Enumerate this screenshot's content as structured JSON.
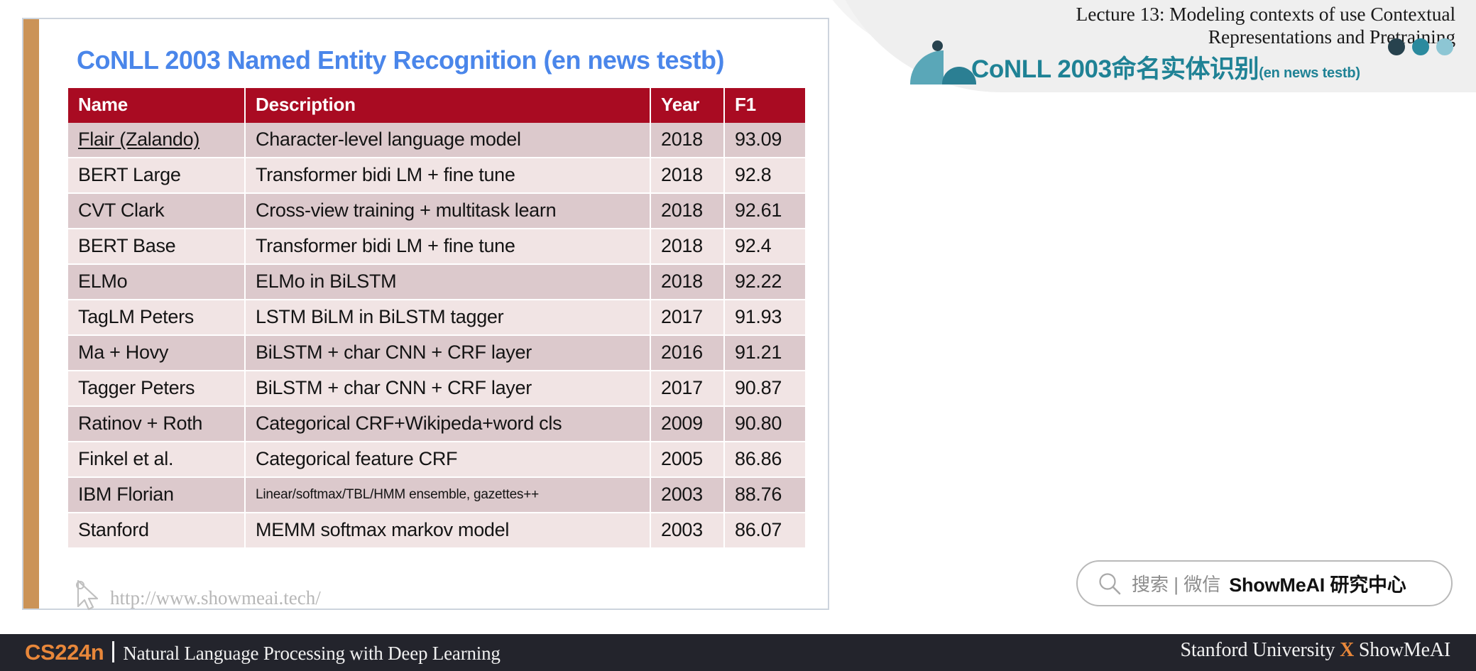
{
  "header": {
    "lecture_line1": "Lecture 13:  Modeling contexts of use Contextual",
    "lecture_line2": "Representations and Pretraining",
    "brand_title": "CoNLL 2003命名实体识别",
    "brand_subtitle": "(en news testb)",
    "dot_colors": [
      "#27424e",
      "#2b8a9e",
      "#8dc6d4"
    ],
    "mark_colors": {
      "quarter": "#5aa7b8",
      "dome": "#2b7f93",
      "dot": "#27424e"
    }
  },
  "card": {
    "title": "CoNLL 2003 Named Entity Recognition (en news testb)",
    "title_color": "#4a86ea",
    "accent_color": "#cb9357",
    "watermark": "http://www.showmeai.tech/"
  },
  "table": {
    "header_color": "#a90b22",
    "row_odd_color": "#dcc9cc",
    "row_even_color": "#f1e4e4",
    "columns": [
      "Name",
      "Description",
      "Year",
      "F1"
    ],
    "rows": [
      {
        "name": "Flair (Zalando)",
        "underline": true,
        "small_desc": false,
        "description": "Character-level language model",
        "year": "2018",
        "f1": "93.09"
      },
      {
        "name": "BERT Large",
        "underline": false,
        "small_desc": false,
        "description": "Transformer bidi LM + fine tune",
        "year": "2018",
        "f1": "92.8"
      },
      {
        "name": "CVT Clark",
        "underline": false,
        "small_desc": false,
        "description": "Cross-view training + multitask learn",
        "year": "2018",
        "f1": "92.61"
      },
      {
        "name": "BERT Base",
        "underline": false,
        "small_desc": false,
        "description": "Transformer bidi LM + fine tune",
        "year": "2018",
        "f1": "92.4"
      },
      {
        "name": "ELMo",
        "underline": false,
        "small_desc": false,
        "description": "ELMo in BiLSTM",
        "year": "2018",
        "f1": "92.22"
      },
      {
        "name": "TagLM Peters",
        "underline": false,
        "small_desc": false,
        "description": "LSTM BiLM in BiLSTM tagger",
        "year": "2017",
        "f1": "91.93"
      },
      {
        "name": "Ma + Hovy",
        "underline": false,
        "small_desc": false,
        "description": "BiLSTM + char CNN + CRF layer",
        "year": "2016",
        "f1": "91.21"
      },
      {
        "name": "Tagger Peters",
        "underline": false,
        "small_desc": false,
        "description": "BiLSTM + char CNN + CRF layer",
        "year": "2017",
        "f1": "90.87"
      },
      {
        "name": "Ratinov + Roth",
        "underline": false,
        "small_desc": false,
        "description": "Categorical CRF+Wikipeda+word cls",
        "year": "2009",
        "f1": "90.80"
      },
      {
        "name": "Finkel et al.",
        "underline": false,
        "small_desc": false,
        "description": "Categorical feature CRF",
        "year": "2005",
        "f1": "86.86"
      },
      {
        "name": "IBM Florian",
        "underline": false,
        "small_desc": true,
        "description": "Linear/softmax/TBL/HMM ensemble, gazettes++",
        "year": "2003",
        "f1": "88.76"
      },
      {
        "name": "Stanford",
        "underline": false,
        "small_desc": false,
        "description": "MEMM softmax markov model",
        "year": "2003",
        "f1": "86.07"
      }
    ]
  },
  "search": {
    "placeholder": "搜索 | 微信",
    "brand": "ShowMeAI 研究中心"
  },
  "footer": {
    "course_code": "CS224n",
    "course_name": "Natural Language Processing with Deep Learning",
    "right_prefix": "Stanford University ",
    "right_x": "X",
    "right_suffix": " ShowMeAI",
    "accent_color": "#e8873a",
    "bg_color": "#23242c"
  }
}
